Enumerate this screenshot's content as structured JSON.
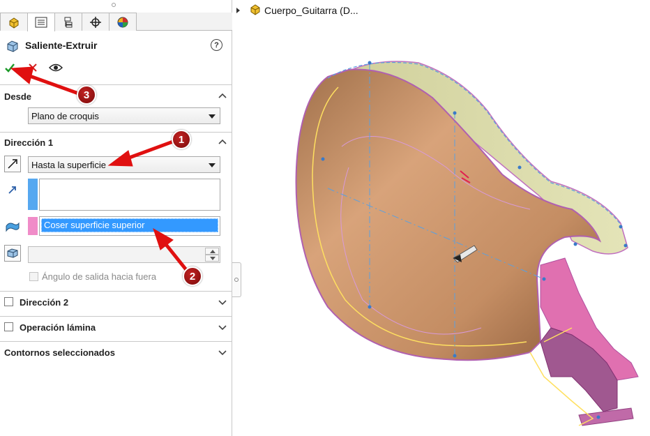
{
  "feature_title": "Saliente-Extruir",
  "tree_item": "Cuerpo_Guitarra  (D...",
  "tabs": [
    {
      "name": "feature-manager-tab",
      "icon": "part-cube-icon"
    },
    {
      "name": "property-manager-tab",
      "icon": "property-list-icon"
    },
    {
      "name": "configuration-manager-tab",
      "icon": "configuration-icon"
    },
    {
      "name": "dimxpert-tab",
      "icon": "crosshair-icon"
    },
    {
      "name": "display-manager-tab",
      "icon": "appearance-pie-icon"
    }
  ],
  "desde": {
    "title": "Desde",
    "value": "Plano de croquis"
  },
  "direccion1": {
    "title": "Dirección 1",
    "end_condition": "Hasta la superficie",
    "direction_list": "",
    "surface_list": "Coser superficie superior",
    "offset_value": "",
    "draft_outward_label": "Ángulo de salida hacia fuera"
  },
  "direccion2": {
    "title": "Dirección 2"
  },
  "thin_feature": {
    "title": "Operación lámina"
  },
  "selected_contours": {
    "title": "Contornos seleccionados"
  },
  "annotations": {
    "badge1": "1",
    "badge2": "2",
    "badge3": "3"
  },
  "colors": {
    "accept": "#1e9a2a",
    "cancel": "#d42020",
    "selection": "#3399ff",
    "direction_tab": "#56a8f0",
    "surface_tab": "#f08cc8",
    "arrow_red": "#e01010",
    "badge": "#a01515"
  }
}
